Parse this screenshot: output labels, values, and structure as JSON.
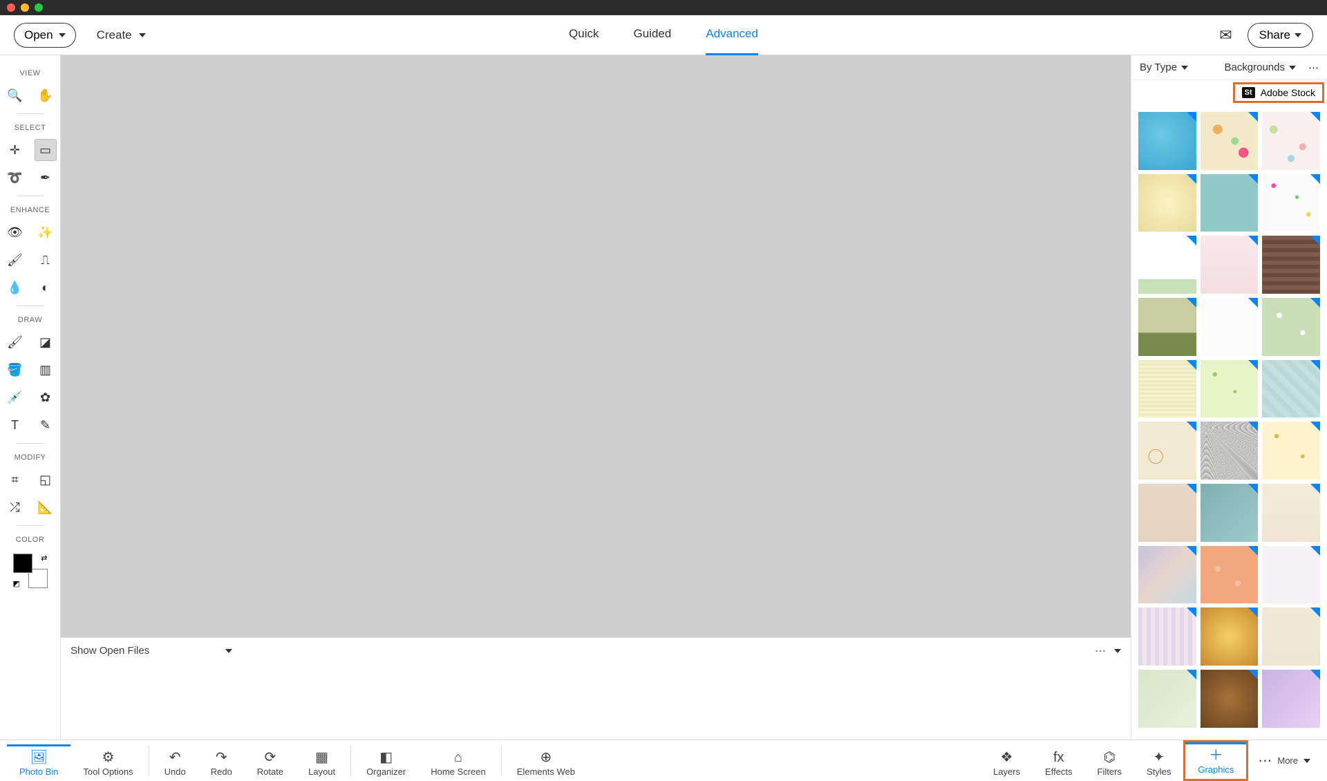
{
  "titlebar": {},
  "topbar": {
    "open": "Open",
    "create": "Create",
    "tabs": [
      "Quick",
      "Guided",
      "Advanced"
    ],
    "active_tab": 2,
    "share": "Share"
  },
  "left": {
    "sections": {
      "view": "VIEW",
      "select": "SELECT",
      "enhance": "ENHANCE",
      "draw": "DRAW",
      "modify": "MODIFY",
      "color": "COLOR"
    }
  },
  "file_strip": {
    "label": "Show Open Files"
  },
  "rightpanel": {
    "filter_label": "By Type",
    "category": "Backgrounds",
    "stock_label": "Adobe Stock",
    "stock_badge": "St",
    "thumbs": [
      {
        "bg": "radial-gradient(circle at 40% 40%, #6bc8e6, #3aa6cf)"
      },
      {
        "bg": "linear-gradient(#f2e9c8,#f2e9c8)",
        "overlay": "radial-gradient(circle at 30% 30%, #f0b060 8%, transparent 9%), radial-gradient(circle at 60% 50%, #9fd88f 8%, transparent 9%), radial-gradient(circle at 75% 70%, #e58 8%, transparent 9%)"
      },
      {
        "bg": "linear-gradient(#f7f0ee,#f7f0ee)",
        "overlay": "radial-gradient(circle at 20% 30%, #c6e0a0 6%, transparent 7%), radial-gradient(circle at 70% 60%, #f5b0b0 6%, transparent 7%), radial-gradient(circle at 50% 80%, #a9d7e5 6%, transparent 7%)"
      },
      {
        "bg": "radial-gradient(ellipse at center, #fbf4c2, #e7da9b)"
      },
      {
        "bg": "linear-gradient(#8fc9c8,#8fc9c8)"
      },
      {
        "bg": "linear-gradient(#fafafa,#fafafa)",
        "overlay": "radial-gradient(circle at 20% 20%, #f4a 3%, transparent 4%), radial-gradient(circle at 60% 40%, #6c6 3%, transparent 4%), radial-gradient(circle at 80% 70%, #fc4 3%, transparent 4%)"
      },
      {
        "bg": "linear-gradient(to top, #c8e0ba 25%, #fff 25%)"
      },
      {
        "bg": "linear-gradient(#f6e8ea,#f3dee2)"
      },
      {
        "bg": "repeating-linear-gradient(0deg,#6a4a3a,#6a4a3a 6px,#7c5c4c 6px,#7c5c4c 12px)"
      },
      {
        "bg": "linear-gradient(to top,#7a8a4a 40%,#c7cda0 40%)"
      },
      {
        "bg": "linear-gradient(#fbfbfb,#fbfbfb)"
      },
      {
        "bg": "linear-gradient(#c7deb8,#c7deb8)",
        "overlay": "radial-gradient(circle at 30% 30%, #fff 4%, transparent 5%), radial-gradient(circle at 70% 60%, #fff 4%, transparent 5%)"
      },
      {
        "bg": "repeating-linear-gradient(0deg,#f5f1c9,#f5f1c9 3px,#ece8c0 3px,#ece8c0 6px)"
      },
      {
        "bg": "linear-gradient(#e6f4c6,#e6f4c6)",
        "overlay": "radial-gradient(circle at 25% 25%, #9c5 3%, transparent 4%), radial-gradient(circle at 60% 55%, #9c5 3%, transparent 4%)"
      },
      {
        "bg": "repeating-linear-gradient(45deg,#b9d8d6,#b9d8d6 8px,#c4e0de 8px,#c4e0de 16px)"
      },
      {
        "bg": "linear-gradient(#f2ead0,#f2ead0)",
        "overlay": "radial-gradient(circle at 30% 60%, transparent 12%, #e07a3a 13%, transparent 14%)"
      },
      {
        "bg": "linear-gradient(#fdfdfb,#fdfdfb)",
        "overlay": "repeating-radial-gradient(circle at 10% 10%, #888 1%, transparent 2%)"
      },
      {
        "bg": "linear-gradient(#fbf3cb,#fbf3cb)",
        "overlay": "radial-gradient(circle at 25% 25%, #e6b54a 3%, transparent 4%), radial-gradient(circle at 70% 60%, #e6b54a 3%, transparent 4%)"
      },
      {
        "bg": "linear-gradient(#e9d8c6,#e5d3c1)"
      },
      {
        "bg": "linear-gradient(135deg,#7fb0ae,#9ecac8)"
      },
      {
        "bg": "linear-gradient(#f3ead8,#efe5d2)"
      },
      {
        "bg": "linear-gradient(135deg,#c7c3dd,#e7d5cc,#c2d9e2)"
      },
      {
        "bg": "linear-gradient(#f2a77f,#f2a77f)",
        "overlay": "radial-gradient(circle at 30% 40%, #fff4 5%, transparent 6%), radial-gradient(circle at 65% 65%, #fff4 5%, transparent 6%)"
      },
      {
        "bg": "linear-gradient(#f6f1f4,#f6f1f4)"
      },
      {
        "bg": "repeating-linear-gradient(90deg,#e4d7e8,#e4d7e8 6px,#f0e6f2 6px,#f0e6f2 12px)"
      },
      {
        "bg": "radial-gradient(circle at 50% 50%,#f4cf6a,#c78a2e)"
      },
      {
        "bg": "linear-gradient(#f0e9d6,#eee6d2)"
      },
      {
        "bg": "linear-gradient(135deg,#d7e6c8,#e8f0dc)"
      },
      {
        "bg": "radial-gradient(circle at 50% 50%,#a67238,#6b4420)"
      },
      {
        "bg": "linear-gradient(135deg,#c9b3e6,#e6d1f2)"
      }
    ]
  },
  "bottombar": {
    "left": [
      {
        "label": "Photo Bin",
        "icon": "🖼",
        "active": true
      },
      {
        "label": "Tool Options",
        "icon": "⚙"
      }
    ],
    "center1": [
      {
        "label": "Undo",
        "icon": "↶"
      },
      {
        "label": "Redo",
        "icon": "↷"
      },
      {
        "label": "Rotate",
        "icon": "⟳"
      },
      {
        "label": "Layout",
        "icon": "▦"
      }
    ],
    "center2": [
      {
        "label": "Organizer",
        "icon": "◧"
      },
      {
        "label": "Home Screen",
        "icon": "⌂"
      }
    ],
    "center3": [
      {
        "label": "Elements Web",
        "icon": "⊕"
      }
    ],
    "right": [
      {
        "label": "Layers",
        "icon": "❖"
      },
      {
        "label": "Effects",
        "icon": "fx"
      },
      {
        "label": "Filters",
        "icon": "⌬"
      },
      {
        "label": "Styles",
        "icon": "✦"
      },
      {
        "label": "Graphics",
        "icon": "＋",
        "active": true,
        "highlight": true
      },
      {
        "label": "More",
        "icon": "⋯"
      }
    ]
  }
}
